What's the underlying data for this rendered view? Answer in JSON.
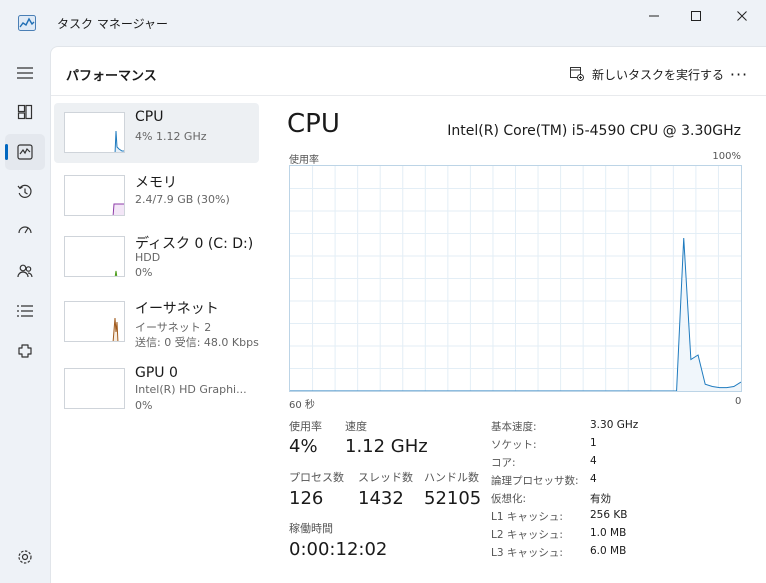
{
  "window": {
    "title": "タスク マネージャー",
    "controls": {
      "minimize_icon": "minimize-icon",
      "maximize_icon": "maximize-icon",
      "close_icon": "close-icon"
    }
  },
  "sidebar": {
    "items": [
      {
        "icon": "hamburger-menu-icon"
      },
      {
        "icon": "processes-icon"
      },
      {
        "icon": "performance-icon",
        "active": true
      },
      {
        "icon": "app-history-icon"
      },
      {
        "icon": "startup-apps-icon"
      },
      {
        "icon": "users-icon"
      },
      {
        "icon": "details-icon"
      },
      {
        "icon": "services-icon"
      },
      {
        "icon": "settings-icon"
      }
    ]
  },
  "header": {
    "page_title": "パフォーマンス",
    "run_task_label": "新しいタスクを実行する",
    "more_label": "···"
  },
  "resources": [
    {
      "name": "CPU",
      "sub1": "4%  1.12 GHz",
      "sub2": "",
      "color": "#1f7bbf",
      "selected": true
    },
    {
      "name": "メモリ",
      "sub1": "2.4/7.9 GB (30%)",
      "sub2": "",
      "color": "#8e3ca8"
    },
    {
      "name": "ディスク 0 (C: D:)",
      "sub1": "HDD",
      "sub2": "0%",
      "color": "#4a9b18"
    },
    {
      "name": "イーサネット",
      "sub1": "イーサネット 2",
      "sub2": "送信: 0 受信: 48.0 Kbps",
      "color": "#a05a1c"
    },
    {
      "name": "GPU 0",
      "sub1": "Intel(R) HD Graphi...",
      "sub2": "0%",
      "color": "#1f7bbf"
    }
  ],
  "detail": {
    "title": "CPU",
    "model": "Intel(R) Core(TM) i5-4590 CPU @ 3.30GHz",
    "util_label": "使用率",
    "util_max": "100%",
    "time_left": "60 秒",
    "time_right": "0",
    "graph_color": "#1f7bbf",
    "graph_fill": "#f0f6fb",
    "usage_history_percent": [
      0,
      0,
      0,
      0,
      0,
      0,
      0,
      0,
      0,
      0,
      0,
      0,
      0,
      0,
      0,
      0,
      0,
      0,
      0,
      0,
      0,
      0,
      0,
      0,
      0,
      0,
      0,
      0,
      0,
      0,
      0,
      0,
      0,
      0,
      0,
      0,
      0,
      0,
      0,
      0,
      0,
      0,
      0,
      0,
      0,
      0,
      0,
      0,
      0,
      0,
      0,
      0,
      0,
      0,
      0,
      68,
      14,
      16,
      3,
      2,
      1.5,
      1.5,
      2,
      4
    ],
    "stats": {
      "usage": {
        "label": "使用率",
        "value": "4%"
      },
      "speed": {
        "label": "速度",
        "value": "1.12 GHz"
      },
      "processes": {
        "label": "プロセス数",
        "value": "126"
      },
      "threads": {
        "label": "スレッド数",
        "value": "1432"
      },
      "handles": {
        "label": "ハンドル数",
        "value": "52105"
      },
      "uptime": {
        "label": "稼働時間",
        "value": "0:00:12:02"
      }
    },
    "specs": [
      {
        "label": "基本速度:",
        "value": "3.30 GHz"
      },
      {
        "label": "ソケット:",
        "value": "1"
      },
      {
        "label": "コア:",
        "value": "4"
      },
      {
        "label": "論理プロセッサ数:",
        "value": "4"
      },
      {
        "label": "仮想化:",
        "value": "有効"
      },
      {
        "label": "L1 キャッシュ:",
        "value": "256 KB"
      },
      {
        "label": "L2 キャッシュ:",
        "value": "1.0 MB"
      },
      {
        "label": "L3 キャッシュ:",
        "value": "6.0 MB"
      }
    ]
  }
}
